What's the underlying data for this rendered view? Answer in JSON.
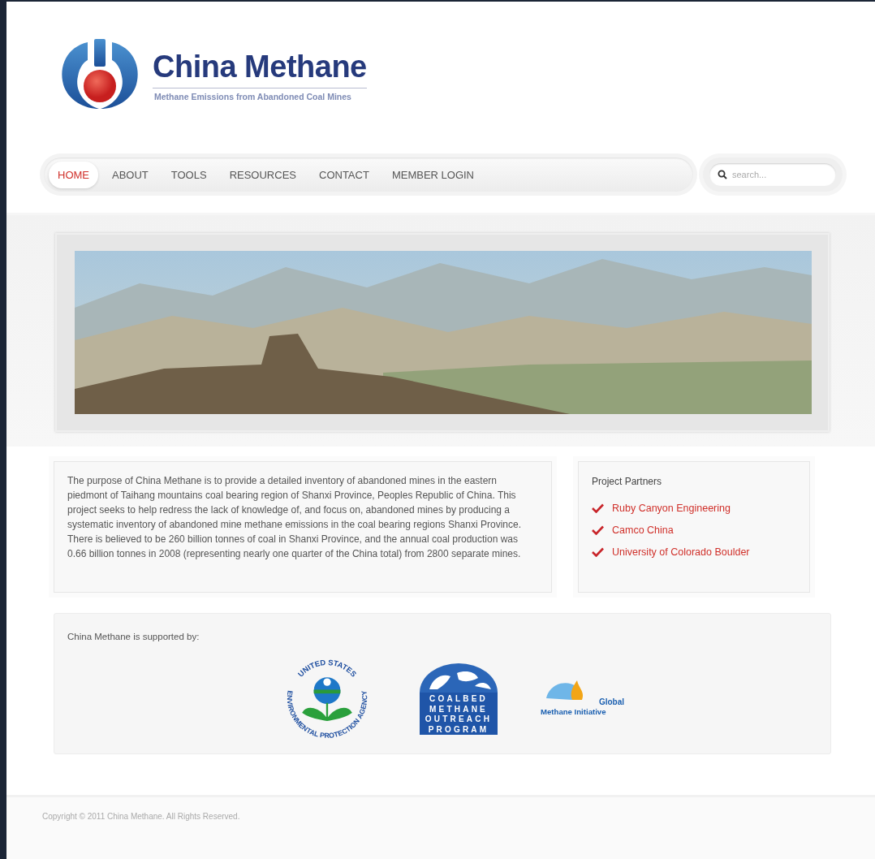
{
  "logo": {
    "title": "China Methane",
    "tagline": "Methane Emissions from Abandoned Coal Mines"
  },
  "nav": {
    "items": [
      {
        "label": "HOME",
        "selected": true
      },
      {
        "label": "ABOUT",
        "selected": false
      },
      {
        "label": "TOOLS",
        "selected": false
      },
      {
        "label": "RESOURCES",
        "selected": false
      },
      {
        "label": "CONTACT",
        "selected": false
      },
      {
        "label": "MEMBER LOGIN",
        "selected": false
      }
    ],
    "search": {
      "placeholder": "search..."
    }
  },
  "intro": {
    "text": "The purpose of China Methane is to provide a detailed inventory of abandoned mines in the eastern piedmont of Taihang mountains coal bearing region of Shanxi Province, Peoples Republic of China. This project seeks to help redress the lack of knowledge of, and focus on, abandoned mines by producing a systematic inventory of abandoned mine methane emissions in the coal bearing regions Shanxi Province. There is believed to be 260 billion tonnes of coal in Shanxi Province, and the annual coal production was 0.66 billion tonnes in 2008 (representing nearly one quarter of the China total) from 2800 separate mines."
  },
  "partners": {
    "title": "Project Partners",
    "items": [
      "Ruby Canyon Engineering",
      "Camco China",
      "University of Colorado Boulder"
    ]
  },
  "supporters": {
    "title": "China Methane is supported by:",
    "logos": [
      {
        "kind": "epa",
        "top_text": "UNITED STATES",
        "bottom_text": "ENVIRONMENTAL PROTECTION AGENCY"
      },
      {
        "kind": "cmop",
        "lines": [
          "COALBED",
          "METHANE",
          "OUTREACH",
          "PROGRAM"
        ]
      },
      {
        "kind": "gmi",
        "lines": [
          "Global",
          "Methane Initiative"
        ]
      }
    ]
  },
  "footer": {
    "copyright": "Copyright © 2011 China Methane. All Rights Reserved."
  }
}
